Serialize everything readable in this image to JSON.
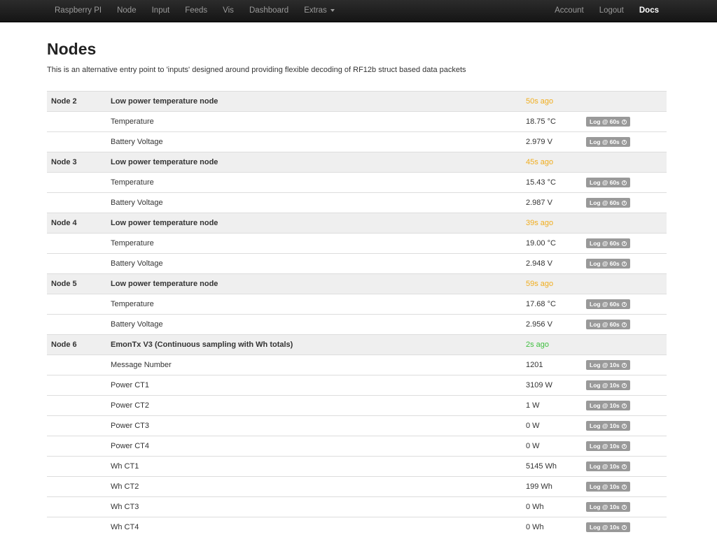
{
  "nav": {
    "left": [
      "Raspberry PI",
      "Node",
      "Input",
      "Feeds",
      "Vis",
      "Dashboard"
    ],
    "extras": "Extras",
    "account": "Account",
    "logout": "Logout",
    "docs": "Docs"
  },
  "page": {
    "title": "Nodes",
    "subtitle": "This is an alternative entry point to 'inputs' designed around providing flexible decoding of RF12b struct based data packets"
  },
  "colors": {
    "ago_warn": "#f0ad1e",
    "ago_ok": "#3fbf3f",
    "badge": "#999999",
    "header_row": "#efefef"
  },
  "nodes": [
    {
      "id": "Node 2",
      "name": "Low power temperature node",
      "ago": "50s ago",
      "status": "warn",
      "variables": [
        {
          "name": "Temperature",
          "value": "18.75 °C",
          "log": "Log @ 60s"
        },
        {
          "name": "Battery Voltage",
          "value": "2.979 V",
          "log": "Log @ 60s"
        }
      ]
    },
    {
      "id": "Node 3",
      "name": "Low power temperature node",
      "ago": "45s ago",
      "status": "warn",
      "variables": [
        {
          "name": "Temperature",
          "value": "15.43 °C",
          "log": "Log @ 60s"
        },
        {
          "name": "Battery Voltage",
          "value": "2.987 V",
          "log": "Log @ 60s"
        }
      ]
    },
    {
      "id": "Node 4",
      "name": "Low power temperature node",
      "ago": "39s ago",
      "status": "warn",
      "variables": [
        {
          "name": "Temperature",
          "value": "19.00 °C",
          "log": "Log @ 60s"
        },
        {
          "name": "Battery Voltage",
          "value": "2.948 V",
          "log": "Log @ 60s"
        }
      ]
    },
    {
      "id": "Node 5",
      "name": "Low power temperature node",
      "ago": "59s ago",
      "status": "warn",
      "variables": [
        {
          "name": "Temperature",
          "value": "17.68 °C",
          "log": "Log @ 60s"
        },
        {
          "name": "Battery Voltage",
          "value": "2.956 V",
          "log": "Log @ 60s"
        }
      ]
    },
    {
      "id": "Node 6",
      "name": "EmonTx V3 (Continuous sampling with Wh totals)",
      "ago": "2s ago",
      "status": "ok",
      "variables": [
        {
          "name": "Message Number",
          "value": "1201",
          "log": "Log @ 10s"
        },
        {
          "name": "Power CT1",
          "value": "3109 W",
          "log": "Log @ 10s"
        },
        {
          "name": "Power CT2",
          "value": "1 W",
          "log": "Log @ 10s"
        },
        {
          "name": "Power CT3",
          "value": "0 W",
          "log": "Log @ 10s"
        },
        {
          "name": "Power CT4",
          "value": "0 W",
          "log": "Log @ 10s"
        },
        {
          "name": "Wh CT1",
          "value": "5145 Wh",
          "log": "Log @ 10s"
        },
        {
          "name": "Wh CT2",
          "value": "199 Wh",
          "log": "Log @ 10s"
        },
        {
          "name": "Wh CT3",
          "value": "0 Wh",
          "log": "Log @ 10s"
        },
        {
          "name": "Wh CT4",
          "value": "0 Wh",
          "log": "Log @ 10s"
        }
      ]
    }
  ]
}
